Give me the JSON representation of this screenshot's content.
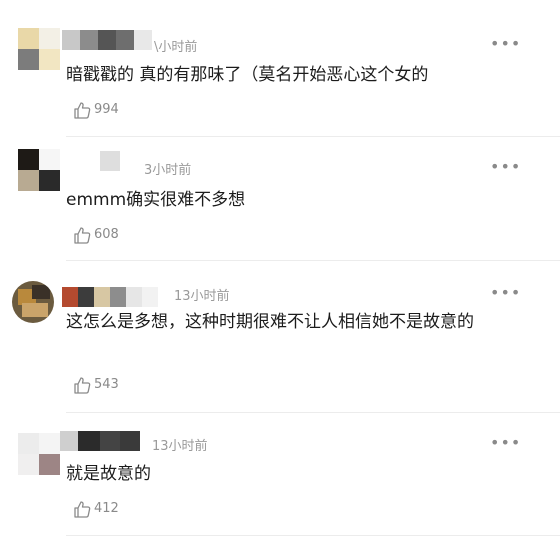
{
  "comments": [
    {
      "time": "\\小时前",
      "content": "暗戳戳的 真的有那味了（莫名开始恶心这个女的",
      "likes": "994"
    },
    {
      "time": "3小时前",
      "content": "emmm确实很难不多想",
      "likes": "608"
    },
    {
      "time": "13小时前",
      "content": "这怎么是多想，这种时期很难不让人相信她不是故意的",
      "likes": "543"
    },
    {
      "time": "13小时前",
      "content": "就是故意的",
      "likes": "412"
    }
  ],
  "icons": {
    "more": "more-dots-icon",
    "like": "thumbs-up-icon"
  },
  "colors": {
    "meta_gray": "#9a9a9a",
    "text": "#1c1c1c",
    "divider": "#ececec"
  }
}
